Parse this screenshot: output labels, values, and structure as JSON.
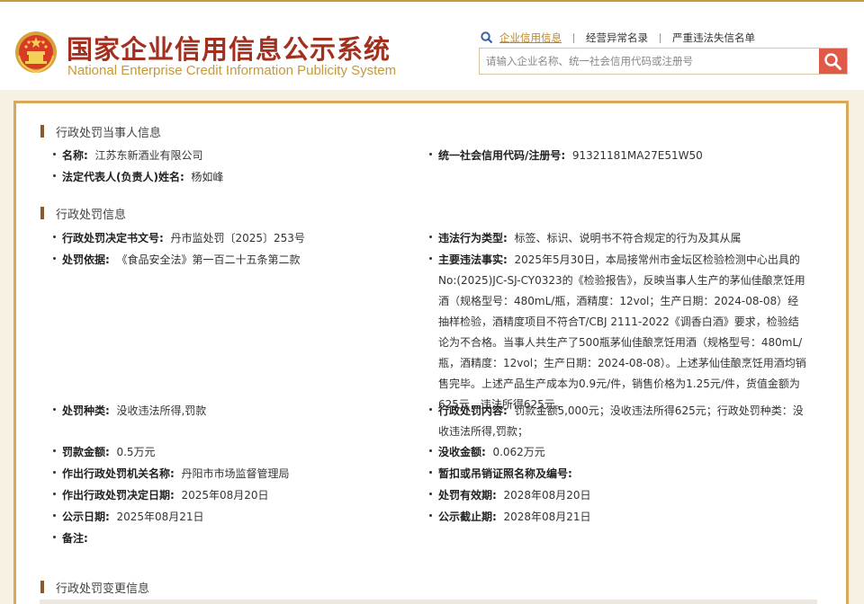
{
  "header": {
    "title_cn": "国家企业信用信息公示系统",
    "title_en": "National Enterprise Credit Information Publicity System",
    "nav": [
      {
        "label": "企业信用信息",
        "active": true
      },
      {
        "label": "经营异常名录",
        "active": false
      },
      {
        "label": "严重违法失信名单",
        "active": false
      }
    ],
    "search": {
      "placeholder": "请输入企业名称、统一社会信用代码或注册号",
      "value": ""
    },
    "icons": {
      "emblem": "national-emblem-icon",
      "nav": "search-icon",
      "button": "search-icon"
    },
    "colors": {
      "title": "#a3301e",
      "title_en": "#c49a3a",
      "search_button": "#e05a4a",
      "accent": "#d9a85a"
    }
  },
  "sections": [
    {
      "title": "行政处罚当事人信息"
    },
    {
      "title": "行政处罚信息"
    },
    {
      "title": "行政处罚变更信息"
    }
  ],
  "party": {
    "name": {
      "label": "名称:",
      "value": "江苏东新酒业有限公司"
    },
    "credit_code": {
      "label": "统一社会信用代码/注册号:",
      "value": "91321181MA27E51W50"
    },
    "legal_rep": {
      "label": "法定代表人(负责人)姓名:",
      "value": "杨如峰"
    }
  },
  "penalty": {
    "decision_no": {
      "label": "行政处罚决定书文号:",
      "value": "丹市监处罚〔2025〕253号"
    },
    "violation_type": {
      "label": "违法行为类型:",
      "value": "标签、标识、说明书不符合规定的行为及其从属"
    },
    "basis": {
      "label": "处罚依据:",
      "value": "《食品安全法》第一百二十五条第二款"
    },
    "main_facts": {
      "label": "主要违法事实:",
      "value": "2025年5月30日，本局接常州市金坛区检验检测中心出具的No:(2025)JC-SJ-CY0323的《检验报告》，反映当事人生产的茅仙佳酿烹饪用酒（规格型号：480mL/瓶，酒精度：12vol；生产日期：2024-08-08）经抽样检验，酒精度项目不符合T/CBJ 2111-2022《调香白酒》要求，检验结论为不合格。当事人共生产了500瓶茅仙佳酿烹饪用酒（规格型号：480mL/瓶，酒精度：12vol；生产日期：2024-08-08）。上述茅仙佳酿烹饪用酒均销售完毕。上述产品生产成本为0.9元/件，销售价格为1.25元/件，货值金额为625元，违法所得625元。"
    },
    "penalty_kind": {
      "label": "处罚种类:",
      "value": "没收违法所得,罚款"
    },
    "penalty_content": {
      "label": "行政处罚内容:",
      "value": "罚款金额5,000元；没收违法所得625元；行政处罚种类：没收违法所得,罚款；"
    },
    "fine_amount": {
      "label": "罚款金额:",
      "value": "0.5万元"
    },
    "confiscated_amount": {
      "label": "没收金额:",
      "value": "0.062万元"
    },
    "authority": {
      "label": "作出行政处罚机关名称:",
      "value": "丹阳市市场监督管理局"
    },
    "license_suspended": {
      "label": "暂扣或吊销证照名称及编号:",
      "value": ""
    },
    "decision_date": {
      "label": "作出行政处罚决定日期:",
      "value": "2025年08月20日"
    },
    "valid_until": {
      "label": "处罚有效期:",
      "value": "2028年08月20日"
    },
    "publish_date": {
      "label": "公示日期:",
      "value": "2025年08月21日"
    },
    "publish_end": {
      "label": "公示截止期:",
      "value": "2028年08月21日"
    },
    "remark": {
      "label": "备注:",
      "value": ""
    }
  }
}
